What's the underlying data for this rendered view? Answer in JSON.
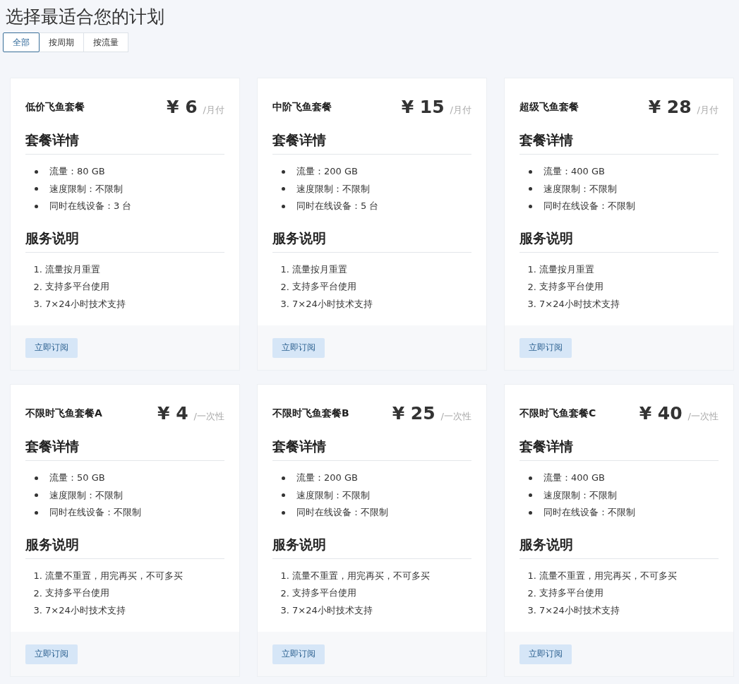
{
  "title": "选择最适合您的计划",
  "tabs": [
    {
      "label": "全部",
      "selected": true
    },
    {
      "label": "按周期",
      "selected": false
    },
    {
      "label": "按流量",
      "selected": false
    }
  ],
  "plans": [
    {
      "name": "低价飞鱼套餐",
      "price": "¥ 6",
      "period": "/月付",
      "details_heading": "套餐详情",
      "details": [
        "流量：80 GB",
        "速度限制：不限制",
        "同时在线设备：3 台"
      ],
      "service_heading": "服务说明",
      "services": [
        {
          "number": "1.",
          "text": "流量按月重置"
        },
        {
          "number": "2.",
          "text": "支持多平台使用"
        },
        {
          "number": "3.",
          "text": "7×24小时技术支持"
        }
      ],
      "button": "立即订阅"
    },
    {
      "name": "中阶飞鱼套餐",
      "price": "¥ 15",
      "period": "/月付",
      "details_heading": "套餐详情",
      "details": [
        "流量：200 GB",
        "速度限制：不限制",
        "同时在线设备：5 台"
      ],
      "service_heading": "服务说明",
      "services": [
        {
          "number": "1.",
          "text": "流量按月重置"
        },
        {
          "number": "2.",
          "text": "支持多平台使用"
        },
        {
          "number": "3.",
          "text": "7×24小时技术支持"
        }
      ],
      "button": "立即订阅"
    },
    {
      "name": "超级飞鱼套餐",
      "price": "¥ 28",
      "period": "/月付",
      "details_heading": "套餐详情",
      "details": [
        "流量：400 GB",
        "速度限制：不限制",
        "同时在线设备：不限制"
      ],
      "service_heading": "服务说明",
      "services": [
        {
          "number": "1.",
          "text": "流量按月重置"
        },
        {
          "number": "2.",
          "text": "支持多平台使用"
        },
        {
          "number": "3.",
          "text": "7×24小时技术支持"
        }
      ],
      "button": "立即订阅"
    },
    {
      "name": "不限时飞鱼套餐A",
      "price": "¥ 4",
      "period": "/一次性",
      "details_heading": "套餐详情",
      "details": [
        "流量：50 GB",
        "速度限制：不限制",
        "同时在线设备：不限制"
      ],
      "service_heading": "服务说明",
      "services": [
        {
          "number": "1.",
          "text": "流量不重置，用完再买，不可多买"
        },
        {
          "number": "2.",
          "text": "支持多平台使用"
        },
        {
          "number": "3.",
          "text": "7×24小时技术支持"
        }
      ],
      "button": "立即订阅"
    },
    {
      "name": "不限时飞鱼套餐B",
      "price": "¥ 25",
      "period": "/一次性",
      "details_heading": "套餐详情",
      "details": [
        "流量：200 GB",
        "速度限制：不限制",
        "同时在线设备：不限制"
      ],
      "service_heading": "服务说明",
      "services": [
        {
          "number": "1.",
          "text": "流量不重置，用完再买，不可多买"
        },
        {
          "number": "2.",
          "text": "支持多平台使用"
        },
        {
          "number": "3.",
          "text": "7×24小时技术支持"
        }
      ],
      "button": "立即订阅"
    },
    {
      "name": "不限时飞鱼套餐C",
      "price": "¥ 40",
      "period": "/一次性",
      "details_heading": "套餐详情",
      "details": [
        "流量：400 GB",
        "速度限制：不限制",
        "同时在线设备：不限制"
      ],
      "service_heading": "服务说明",
      "services": [
        {
          "number": "1.",
          "text": "流量不重置，用完再买，不可多买"
        },
        {
          "number": "2.",
          "text": "支持多平台使用"
        },
        {
          "number": "3.",
          "text": "7×24小时技术支持"
        }
      ],
      "button": "立即订阅"
    }
  ]
}
